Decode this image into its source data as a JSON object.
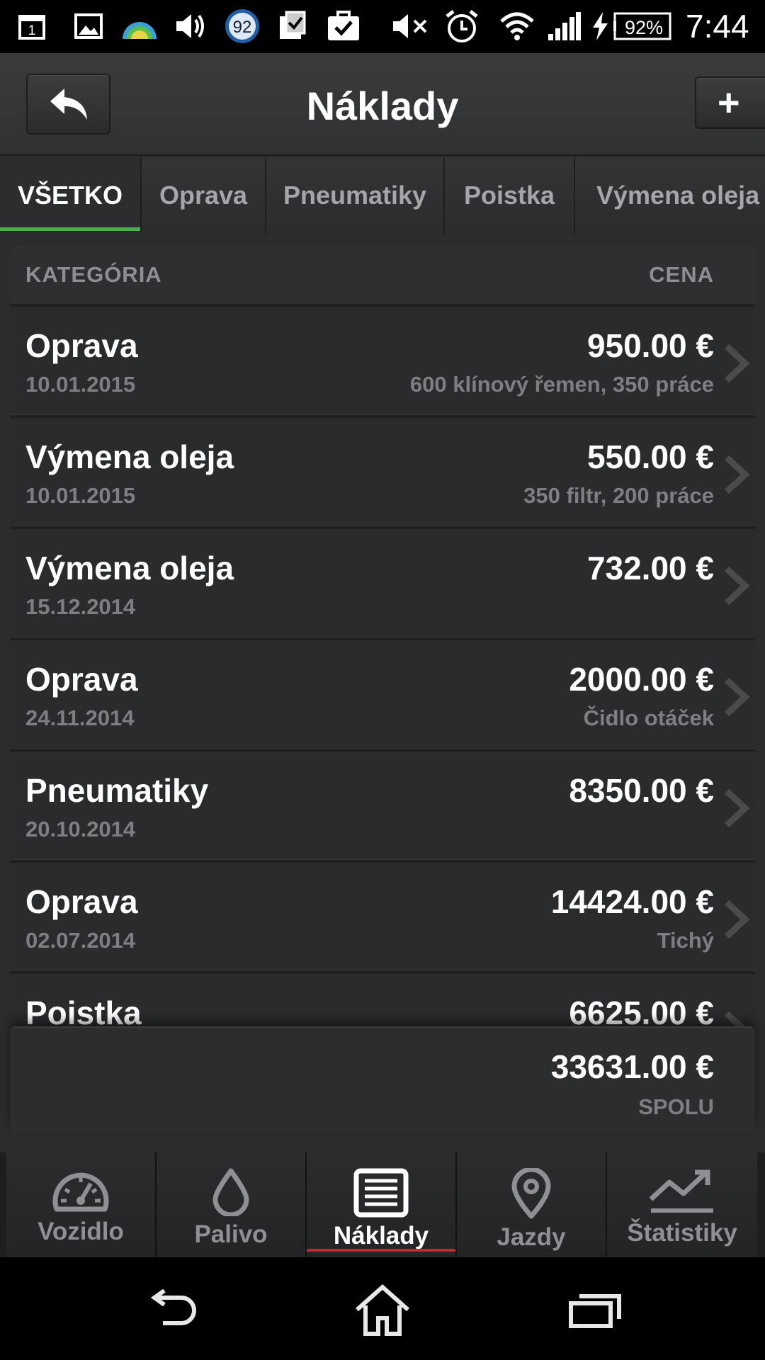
{
  "status_bar": {
    "calendar_day": "1",
    "badge_number": "92",
    "battery_percent": "92%",
    "time": "7:44",
    "icons": [
      "calendar-icon",
      "image-icon",
      "weather-icon",
      "volume-icon",
      "badge-icon",
      "clipboard-check-icon",
      "briefcase-check-icon",
      "mute-icon",
      "alarm-icon",
      "wifi-icon",
      "signal-icon",
      "charging-icon",
      "battery-icon"
    ]
  },
  "action_bar": {
    "title": "Náklady",
    "back_icon": "reply-arrow-icon",
    "add_label": "+"
  },
  "tabs": [
    {
      "label": "VŠETKO",
      "active": true
    },
    {
      "label": "Oprava",
      "active": false
    },
    {
      "label": "Pneumatiky",
      "active": false
    },
    {
      "label": "Poistka",
      "active": false
    },
    {
      "label": "Výmena oleja",
      "active": false
    }
  ],
  "list": {
    "header_category": "KATEGÓRIA",
    "header_price": "CENA",
    "rows": [
      {
        "category": "Oprava",
        "date": "10.01.2015",
        "price": "950.00 €",
        "note": "600 klínový řemen, 350 práce"
      },
      {
        "category": "Výmena oleja",
        "date": "10.01.2015",
        "price": "550.00 €",
        "note": "350 filtr, 200 práce"
      },
      {
        "category": "Výmena oleja",
        "date": "15.12.2014",
        "price": "732.00 €",
        "note": ""
      },
      {
        "category": "Oprava",
        "date": "24.11.2014",
        "price": "2000.00 €",
        "note": "Čidlo otáček"
      },
      {
        "category": "Pneumatiky",
        "date": "20.10.2014",
        "price": "8350.00 €",
        "note": ""
      },
      {
        "category": "Oprava",
        "date": "02.07.2014",
        "price": "14424.00 €",
        "note": "Tichý"
      },
      {
        "category": "Poistka",
        "date": "",
        "price": "6625.00 €",
        "note": ""
      }
    ]
  },
  "total": {
    "amount": "33631.00 €",
    "label": "SPOLU"
  },
  "bottom_nav": [
    {
      "label": "Vozidlo",
      "icon": "speedometer-icon",
      "active": false
    },
    {
      "label": "Palivo",
      "icon": "fuel-drop-icon",
      "active": false
    },
    {
      "label": "Náklady",
      "icon": "document-list-icon",
      "active": true
    },
    {
      "label": "Jazdy",
      "icon": "map-pin-icon",
      "active": false
    },
    {
      "label": "Štatistiky",
      "icon": "trend-chart-icon",
      "active": false
    }
  ],
  "system_nav": [
    "back-icon",
    "home-icon",
    "recent-apps-icon"
  ],
  "colors": {
    "active_tab_indicator": "#4caf50",
    "active_nav_indicator": "#c62828",
    "background": "#2b2c2e"
  }
}
